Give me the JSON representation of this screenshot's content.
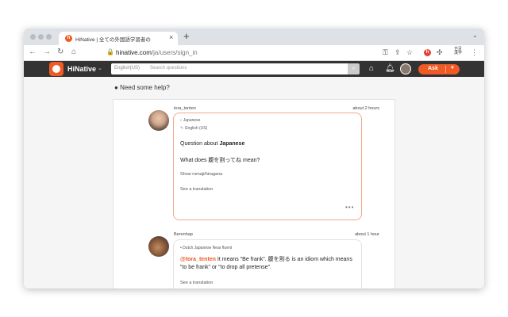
{
  "browser": {
    "tab": {
      "title": "HiNative | 全ての外国語学習者の",
      "favicon": "hinative-icon"
    },
    "url_host": "hinative.com",
    "url_path": "/ja/users/sign_in",
    "new_tab_symbol": "+",
    "close_symbol": "×"
  },
  "header": {
    "brand": "HiNative",
    "language_select": "English(US)",
    "search_placeholder": "Search questions",
    "ask_label": "Ask"
  },
  "page": {
    "need_help": "Need some help?"
  },
  "question": {
    "user": "tora_tenten",
    "time": "about 2 hours",
    "language_primary": "Japanese",
    "language_secondary": "English (US)",
    "topic_prefix": "Question about",
    "topic_language": "Japanese",
    "body": "What does 腹を割ってね mean?",
    "show_romaji": "Show romaji/hiragana",
    "see_translation": "See a translation",
    "more_symbol": "•••"
  },
  "answer": {
    "user": "Berenhap",
    "time": "about 1 hour",
    "languages": "Dutch   Japanese Near fluent",
    "mention": "@tora_tenten",
    "body": " It means \"Be frank\". 腹を割る is an idiom which means \"to be frank\" or \"to drop all pretense\".",
    "see_translation": "See a translation"
  },
  "colors": {
    "accent": "#f05a24",
    "header_bg": "#333333",
    "bubble_border": "#f5a88a"
  }
}
